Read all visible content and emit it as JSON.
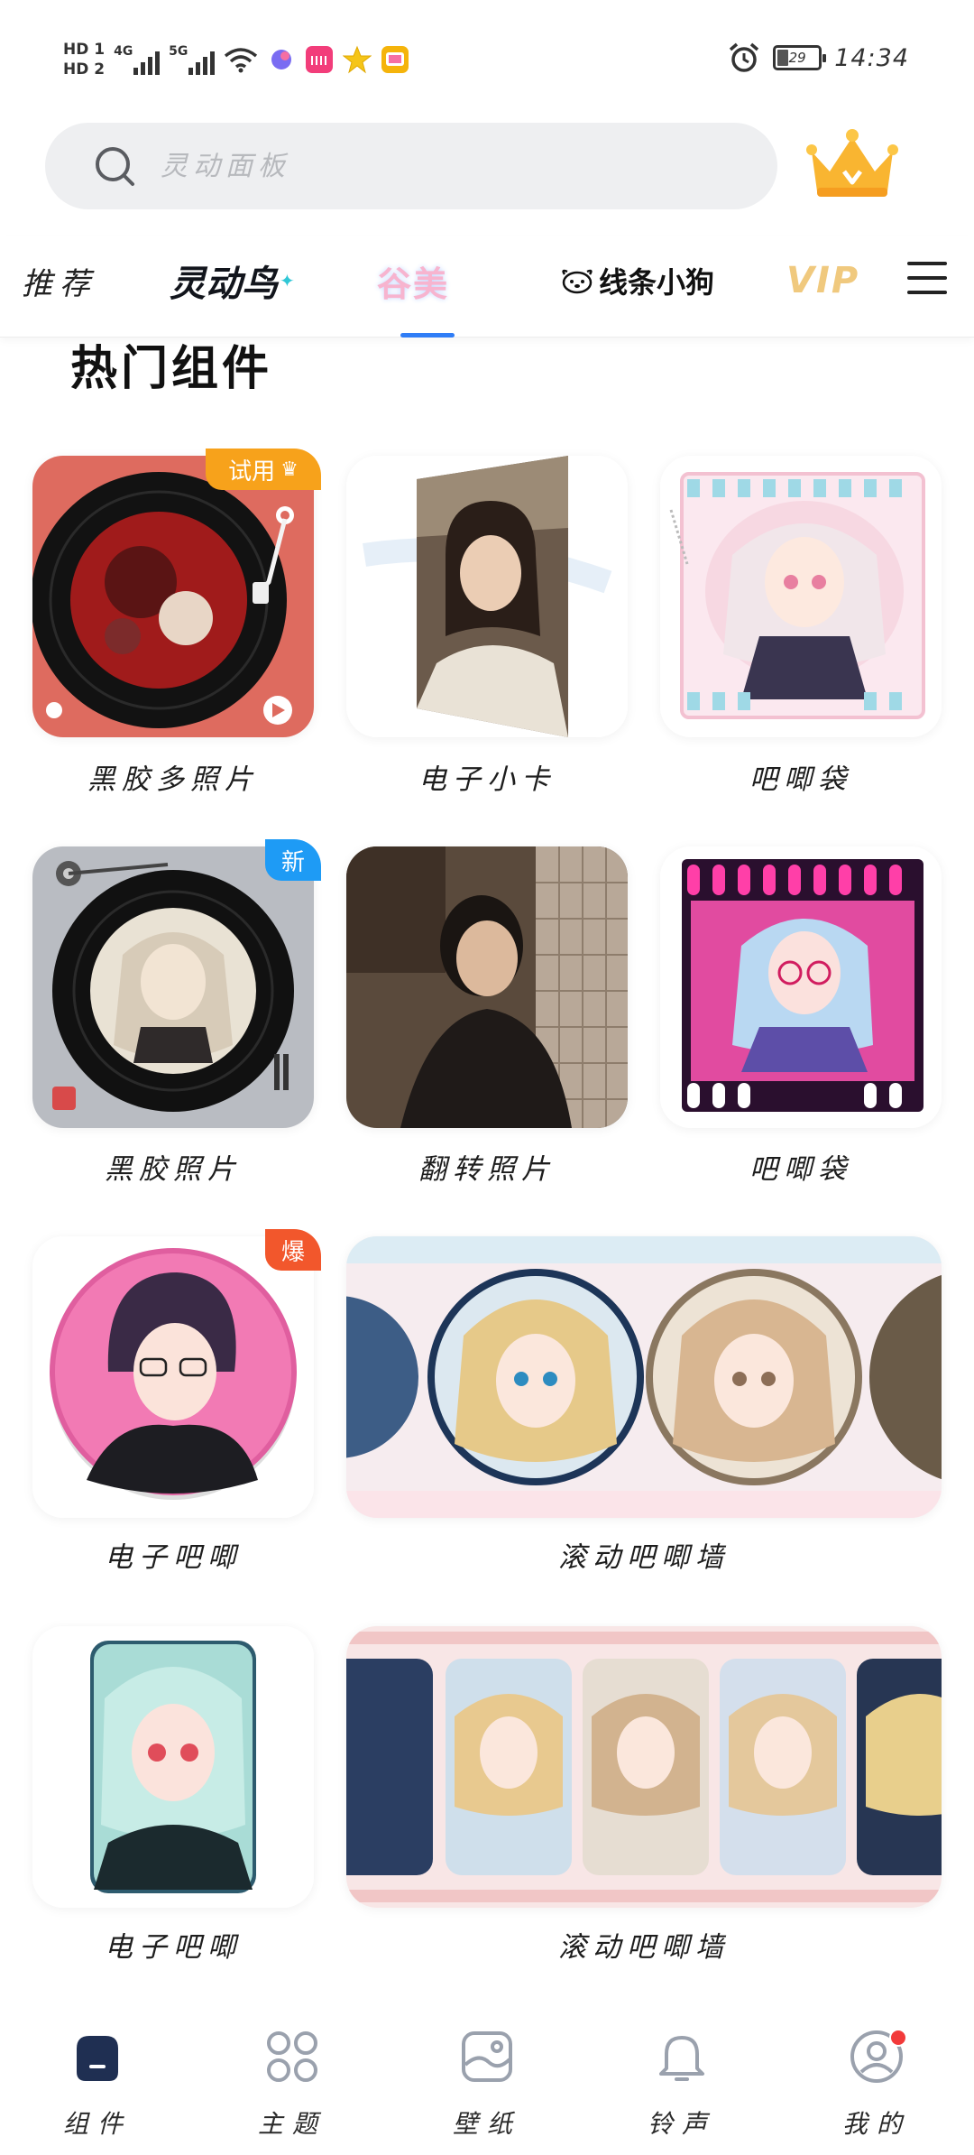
{
  "status_bar": {
    "hd1": "HD 1",
    "hd2": "HD 2",
    "net_4g": "4G",
    "net_5g": "5G",
    "battery_level": "29",
    "time": "14:34"
  },
  "search": {
    "placeholder": "灵动面板"
  },
  "tabs": {
    "recommend": "推荐",
    "lingdongniao": "灵动鸟",
    "gumei": "谷美",
    "xiantiaoxiaogou": "线条小狗",
    "vip": "VIP",
    "active": "谷美"
  },
  "section": {
    "title": "热门组件"
  },
  "widgets": [
    {
      "label": "黑胶多照片",
      "badge": "试用"
    },
    {
      "label": "电子小卡",
      "badge": ""
    },
    {
      "label": "吧唧袋",
      "badge": ""
    },
    {
      "label": "黑胶照片",
      "badge": "新"
    },
    {
      "label": "翻转照片",
      "badge": ""
    },
    {
      "label": "吧唧袋",
      "badge": ""
    },
    {
      "label": "电子吧唧",
      "badge": "爆"
    },
    {
      "label": "滚动吧唧墙",
      "badge": ""
    },
    {
      "label": "电子吧唧",
      "badge": ""
    },
    {
      "label": "滚动吧唧墙",
      "badge": ""
    }
  ],
  "bottom_nav": [
    {
      "label": "组件",
      "icon": "widget-icon",
      "active": true
    },
    {
      "label": "主题",
      "icon": "theme-icon",
      "active": false
    },
    {
      "label": "壁纸",
      "icon": "wallpaper-icon",
      "active": false
    },
    {
      "label": "铃声",
      "icon": "bell-icon",
      "active": false
    },
    {
      "label": "我的",
      "icon": "profile-icon",
      "active": false
    }
  ],
  "colors": {
    "accent": "#2f7df6",
    "badge_trial": "#f7a21b",
    "badge_new": "#1e9bf5",
    "badge_hot": "#f2572c",
    "notify_dot": "#f23a3a"
  }
}
